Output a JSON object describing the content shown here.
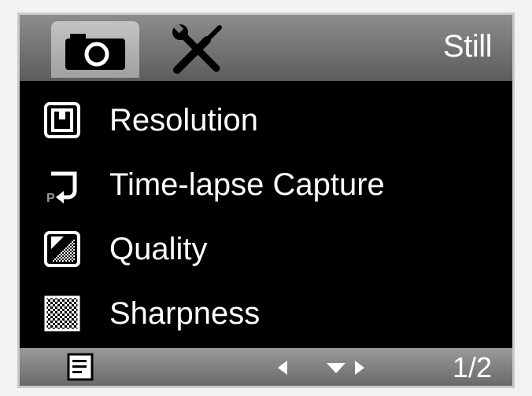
{
  "header": {
    "tabs": [
      {
        "icon": "camera-icon",
        "selected": true
      },
      {
        "icon": "settings-tools-icon",
        "selected": false
      }
    ],
    "mode_label": "Still"
  },
  "menu": {
    "items": [
      {
        "label": "Resolution",
        "icon": "resolution-icon"
      },
      {
        "label": "Time-lapse Capture",
        "icon": "time-lapse-icon"
      },
      {
        "label": "Quality",
        "icon": "quality-icon"
      },
      {
        "label": "Sharpness",
        "icon": "sharpness-icon"
      }
    ]
  },
  "footer": {
    "menu_icon": "menu-list-icon",
    "nav_icons": [
      "left-arrow-icon",
      "down-arrow-icon",
      "right-arrow-icon"
    ],
    "page_indicator": "1/2"
  },
  "colors": {
    "screen_background": "#000000",
    "bar_gray": "#707070",
    "text": "#ffffff"
  }
}
